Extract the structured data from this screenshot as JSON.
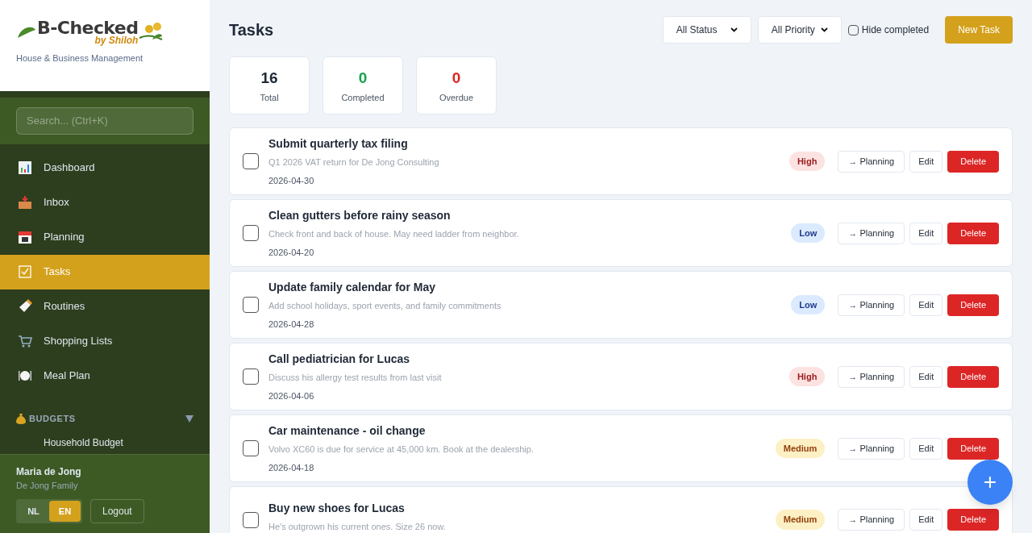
{
  "brand": {
    "name": "B-Checked",
    "byline": "by Shiloh",
    "tagline": "House & Business Management"
  },
  "search": {
    "placeholder": "Search... (Ctrl+K)"
  },
  "nav": [
    {
      "label": "Dashboard",
      "selected": false
    },
    {
      "label": "Inbox",
      "selected": false
    },
    {
      "label": "Planning",
      "selected": false
    },
    {
      "label": "Tasks",
      "selected": true
    },
    {
      "label": "Routines",
      "selected": false
    },
    {
      "label": "Shopping Lists",
      "selected": false
    },
    {
      "label": "Meal Plan",
      "selected": false
    }
  ],
  "budgets": {
    "label": "BUDGETS",
    "expanded": true,
    "items": [
      "Household Budget"
    ]
  },
  "user": {
    "name": "Maria de Jong",
    "family": "De Jong Family",
    "languages": [
      {
        "label": "NL",
        "selected": false
      },
      {
        "label": "EN",
        "selected": true
      }
    ],
    "logout": "Logout"
  },
  "page": {
    "title": "Tasks",
    "status_filter": "All Status",
    "priority_filter": "All Priority",
    "hide_completed": {
      "label": "Hide completed",
      "checked": false
    },
    "new_button": "New Task"
  },
  "stats": [
    {
      "value": "16",
      "label": "Total",
      "kind": "total"
    },
    {
      "value": "0",
      "label": "Completed",
      "kind": "completed"
    },
    {
      "value": "0",
      "label": "Overdue",
      "kind": "overdue"
    }
  ],
  "tasks": [
    {
      "title": "Submit quarterly tax filing",
      "description": "Q1 2026 VAT return for De Jong Consulting",
      "date": "2026-04-30",
      "priority": "High",
      "kind": "high",
      "checked": false,
      "actions": [
        "→ Planning",
        "Edit",
        "Delete"
      ]
    },
    {
      "title": "Clean gutters before rainy season",
      "description": "Check front and back of house. May need ladder from neighbor.",
      "date": "2026-04-20",
      "priority": "Low",
      "kind": "low",
      "checked": false,
      "actions": [
        "→ Planning",
        "Edit",
        "Delete"
      ]
    },
    {
      "title": "Update family calendar for May",
      "description": "Add school holidays, sport events, and family commitments",
      "date": "2026-04-28",
      "priority": "Low",
      "kind": "low",
      "checked": false,
      "actions": [
        "→ Planning",
        "Edit",
        "Delete"
      ]
    },
    {
      "title": "Call pediatrician for Lucas",
      "description": "Discuss his allergy test results from last visit",
      "date": "2026-04-06",
      "priority": "High",
      "kind": "high",
      "checked": false,
      "actions": [
        "→ Planning",
        "Edit",
        "Delete"
      ]
    },
    {
      "title": "Car maintenance - oil change",
      "description": "Volvo XC60 is due for service at 45,000 km. Book at the dealership.",
      "date": "2026-04-18",
      "priority": "Medium",
      "kind": "medium",
      "checked": false,
      "actions": [
        "→ Planning",
        "Edit",
        "Delete"
      ]
    },
    {
      "title": "Buy new shoes for Lucas",
      "description": "He's outgrown his current ones. Size 26 now.",
      "priority": "Medium",
      "kind": "medium",
      "checked": false,
      "actions": [
        "→ Planning",
        "Edit",
        "Delete"
      ]
    }
  ],
  "fab": "+"
}
